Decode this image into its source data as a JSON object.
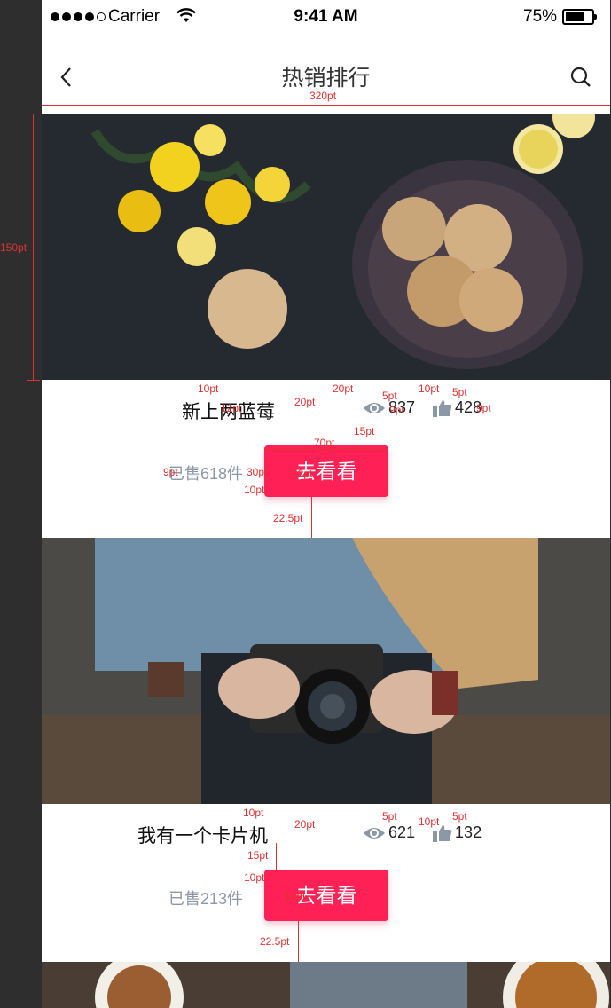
{
  "status_bar": {
    "carrier": "Carrier",
    "time": "9:41 AM",
    "battery": "75%",
    "signal_dots": [
      true,
      true,
      true,
      true,
      false
    ]
  },
  "nav": {
    "title": "热销排行",
    "width_annotation": "320pt"
  },
  "items": [
    {
      "title": "新上两蓝莓",
      "views": "837",
      "likes": "428",
      "sold": "已售618件",
      "button": "去看看"
    },
    {
      "title": "我有一个卡片机",
      "views": "621",
      "likes": "132",
      "sold": "已售213件",
      "button": "去看看"
    }
  ],
  "annotations": {
    "image_height": "150pt",
    "a10": "10pt",
    "a12": "12pt",
    "a20": "20pt",
    "a5": "5pt",
    "a9": "9pt",
    "a15": "15pt",
    "a70": "70pt",
    "a30": "30pt",
    "a22": "22.5pt"
  },
  "colors": {
    "accent": "#ff2155",
    "muted": "#8c98a8",
    "annotation": "#d33"
  }
}
